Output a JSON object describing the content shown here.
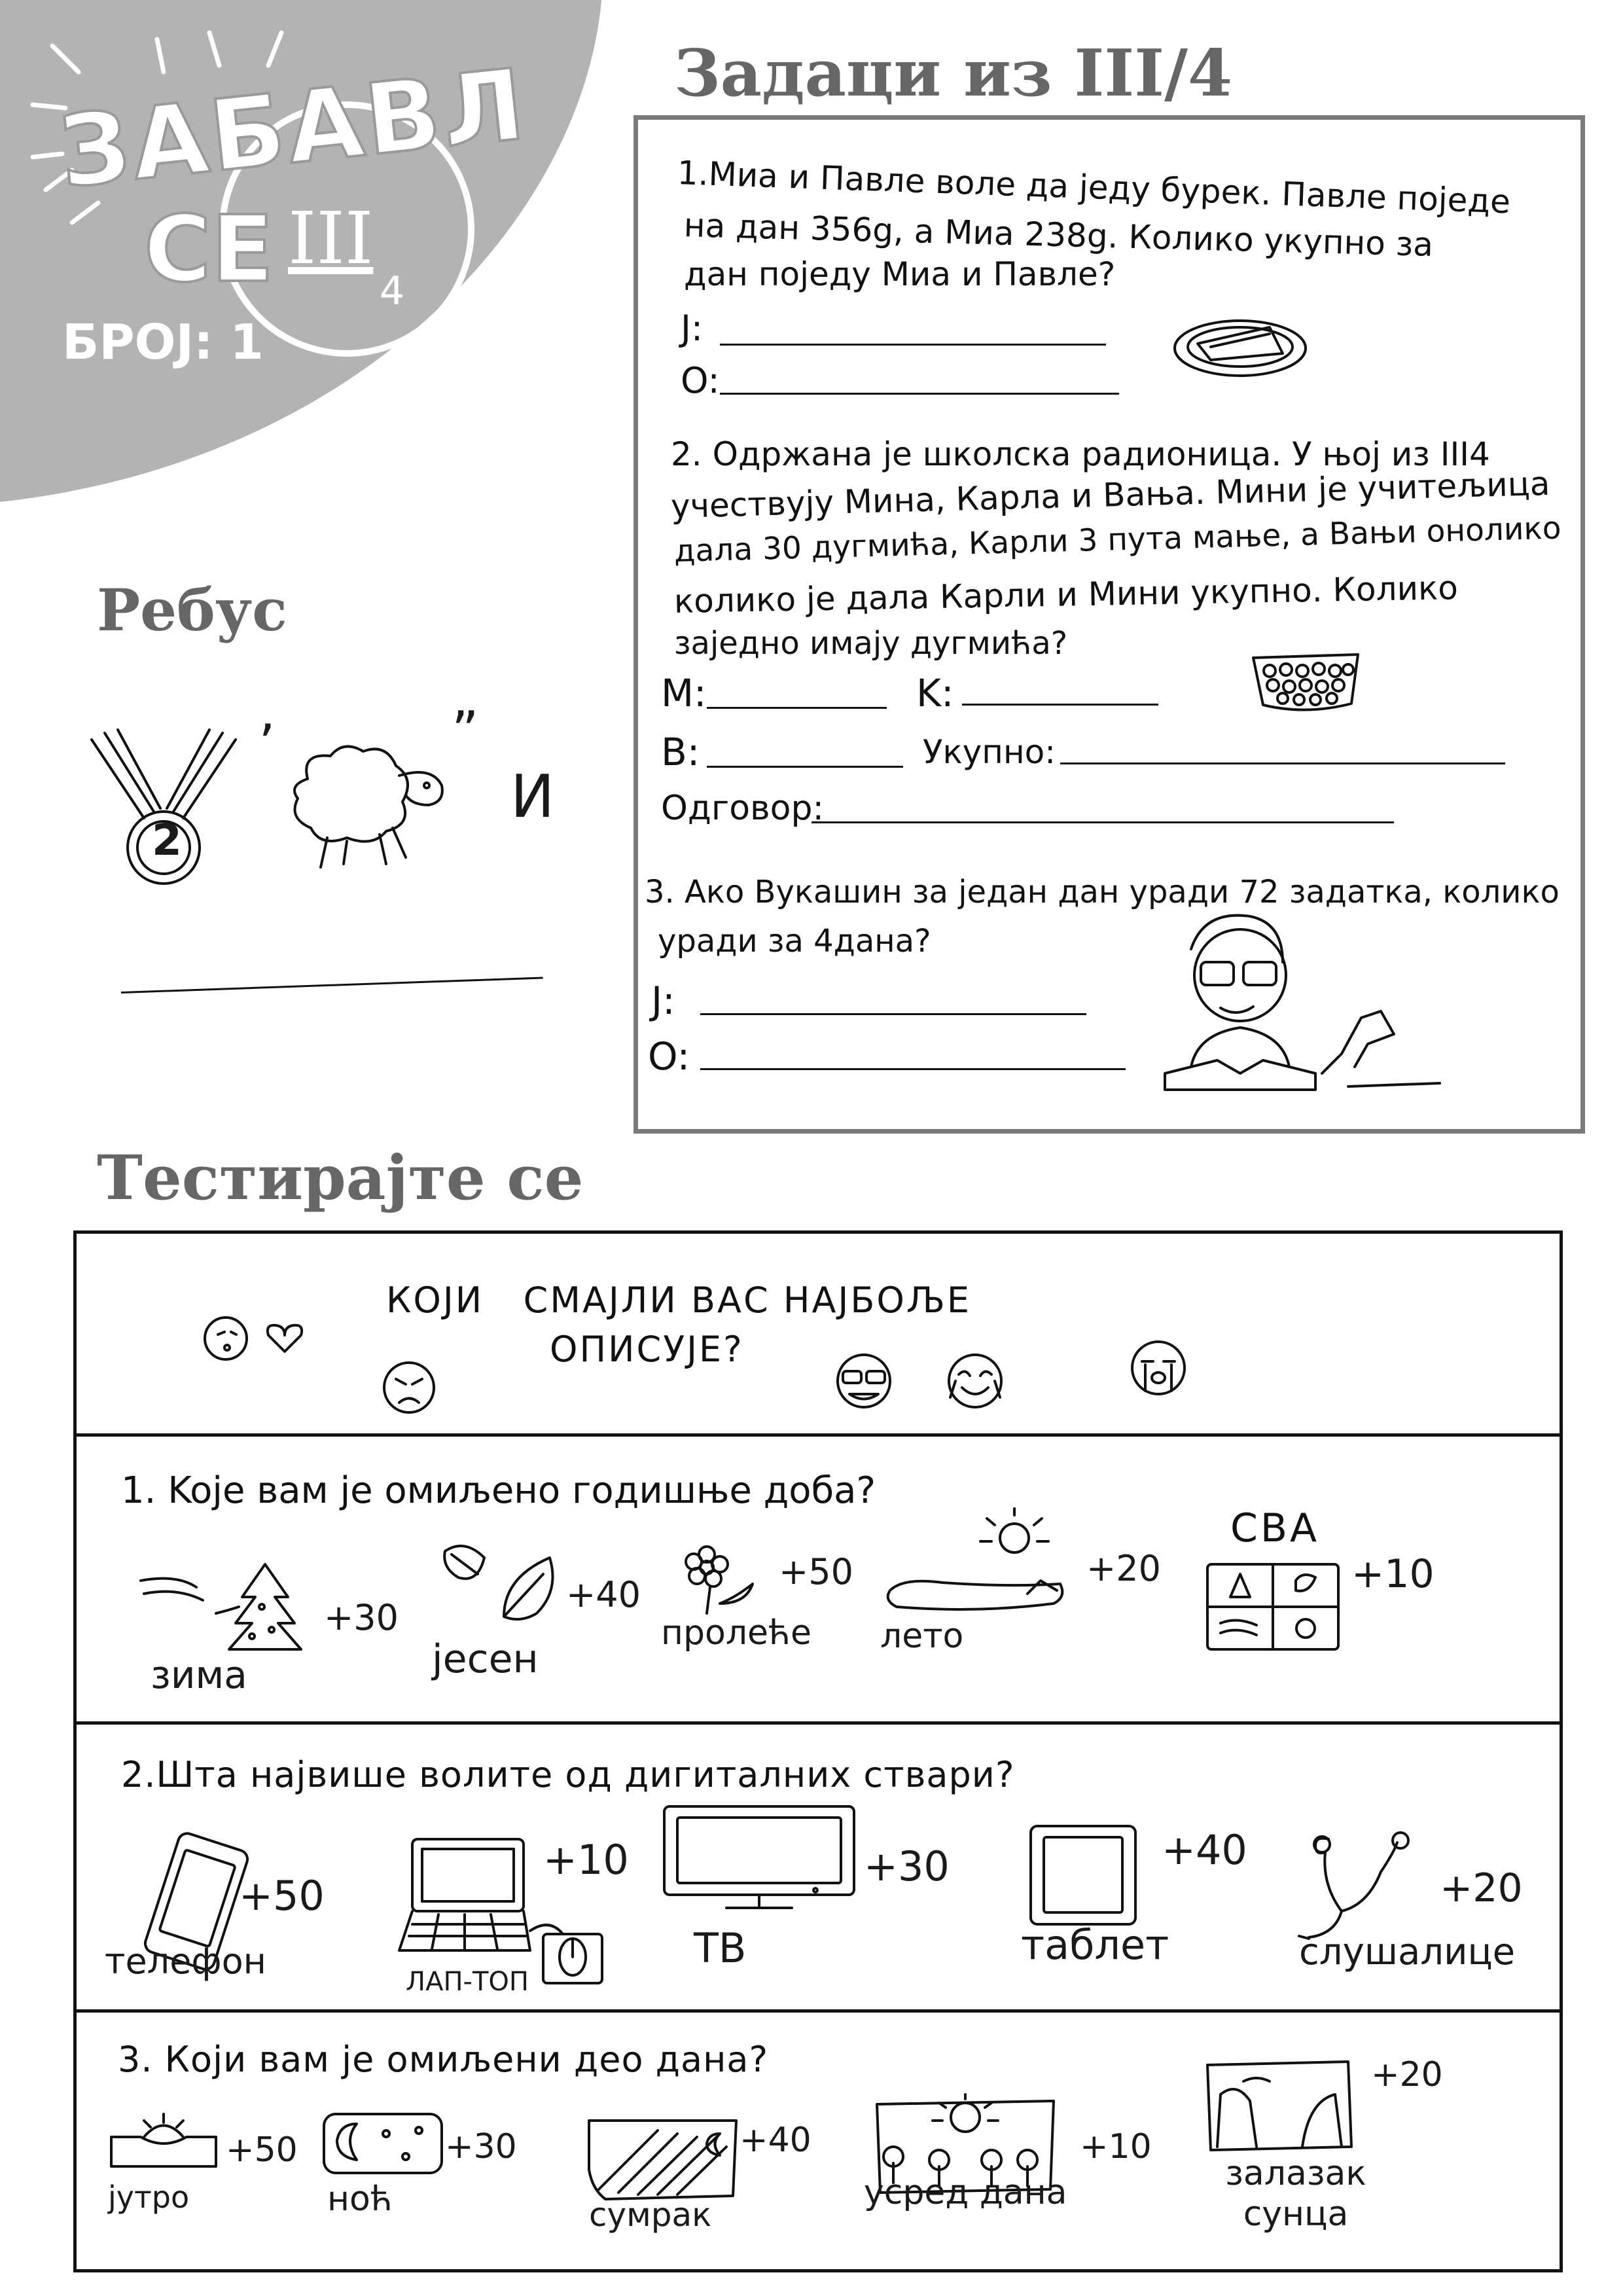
{
  "logo": {
    "title_line1": "ЗАБАВЛ",
    "title_line2": "СЕ",
    "class_numeral": "III",
    "class_sub": "4",
    "issue": "БРОЈ: 1"
  },
  "tasks_section": {
    "heading": "Задаци из III/4",
    "task1": {
      "line1": "1.Миа и Павле воле да једу бурек. Павле поједе",
      "line2": "на дан  356g, а Миа 238g. Колико укупно за",
      "line3": "дан поједу Миа и Павле?",
      "label_j": "J:",
      "label_o": "O:"
    },
    "task2": {
      "line1": "2. Одржана је школска радионица. У њој из III4",
      "line2": "учествују Мина, Карла и Вања. Мини је учитељица",
      "line3": "дала 30 дугмића, Карли 3 пута мање, а Вањи онолико",
      "line4": "колико је дала Карли и Мини укупно. Колико",
      "line5": "заједно имају дугмића?",
      "label_m": "M:",
      "label_k": "K:",
      "label_v": "B:",
      "label_total": "Укупно:",
      "label_answer": "Одговор:"
    },
    "task3": {
      "line1": "3. Ако Вукашин за један дан уради 72 задатка, колико",
      "line2": "уради за 4дана?",
      "label_j": "J:",
      "label_o": "O:"
    }
  },
  "rebus": {
    "heading": "Ребус",
    "medal_number": "2",
    "apostrophe1": "’",
    "apostrophe2": "”",
    "letter": "И"
  },
  "quiz": {
    "heading": "Тестирајте се",
    "intro": {
      "line1": "КОЈИ   СМАЈЛИ ВАС НАЈБОЉЕ",
      "line2": "ОПИСУЈЕ?"
    },
    "q1": {
      "question": "1. Koje вам je омиљено годишње доба?",
      "options": [
        {
          "label": "зима",
          "points": "+30"
        },
        {
          "label": "јесен",
          "points": "+40"
        },
        {
          "label": "пролеће",
          "points": "+50"
        },
        {
          "label": "лето",
          "points": "+20"
        },
        {
          "label": "СВА",
          "points": "+10"
        }
      ]
    },
    "q2": {
      "question": "2.Шта највише волите од дигиталних ствари?",
      "options": [
        {
          "label": "телефон",
          "points": "+50"
        },
        {
          "label": "ЛАП-ТОП",
          "points": "+10"
        },
        {
          "label": "ТВ",
          "points": "+30"
        },
        {
          "label": "таблет",
          "points": "+40"
        },
        {
          "label": "слушалице",
          "points": "+20"
        }
      ]
    },
    "q3": {
      "question": "3. Који вам је омиљени део дана?",
      "options": [
        {
          "label": "јутро",
          "points": "+50"
        },
        {
          "label": "ноћ",
          "points": "+30"
        },
        {
          "label": "сумрак",
          "points": "+40"
        },
        {
          "label": "усред дана",
          "points": "+10"
        },
        {
          "label": "залазак сунца",
          "points": "+20"
        }
      ]
    }
  },
  "colors": {
    "corner_gray": "#b3b3b3",
    "heading_gray": "#666666",
    "frame_gray": "#7a7a7a",
    "ink": "#111111"
  }
}
